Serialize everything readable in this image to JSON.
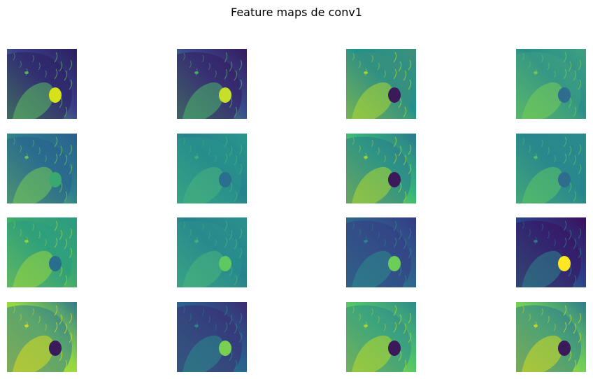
{
  "title": "Feature maps de conv1",
  "colormap": [
    "#440154",
    "#3b528b",
    "#21918c",
    "#5ec962",
    "#fde725"
  ],
  "feature_maps": [
    {
      "index": 1,
      "bg": "#3b3f8a",
      "fur": "#2a1f5e",
      "tongue": "#d8e219",
      "light": "#5ec962"
    },
    {
      "index": 2,
      "bg": "#3a4a8c",
      "fur": "#35195e",
      "tongue": "#c8df2a",
      "light": "#4cbf6b"
    },
    {
      "index": 3,
      "bg": "#21918c",
      "fur": "#3f8f7a",
      "tongue": "#3b1a5a",
      "light": "#b5de2b"
    },
    {
      "index": 4,
      "bg": "#2a8e8a",
      "fur": "#3fa080",
      "tongue": "#2f6c8e",
      "light": "#7ad151"
    },
    {
      "index": 5,
      "bg": "#2c7e8e",
      "fur": "#2a5f8e",
      "tongue": "#3aa86f",
      "light": "#7ad151"
    },
    {
      "index": 6,
      "bg": "#26828e",
      "fur": "#2a968b",
      "tongue": "#2b6f8e",
      "light": "#49b57c"
    },
    {
      "index": 7,
      "bg": "#35b779",
      "fur": "#2a788e",
      "tongue": "#3b1a5a",
      "light": "#b5de2b"
    },
    {
      "index": 8,
      "bg": "#25858e",
      "fur": "#2c8b8c",
      "tongue": "#2e6d8e",
      "light": "#5ec962"
    },
    {
      "index": 9,
      "bg": "#3aa870",
      "fur": "#2a9a83",
      "tongue": "#2a6e8e",
      "light": "#a0da39"
    },
    {
      "index": 10,
      "bg": "#26828e",
      "fur": "#2a918c",
      "tongue": "#5ec962",
      "light": "#4cb87a"
    },
    {
      "index": 11,
      "bg": "#30618d",
      "fur": "#343a84",
      "tongue": "#6ccd5a",
      "light": "#2b8f8c"
    },
    {
      "index": 12,
      "bg": "#2c3e87",
      "fur": "#3a0f5c",
      "tongue": "#fde725",
      "light": "#2c8a8d"
    },
    {
      "index": 13,
      "bg": "#8fd744",
      "fur": "#2f7b8e",
      "tongue": "#3b1a5a",
      "light": "#e2e418"
    },
    {
      "index": 14,
      "bg": "#2a5f8d",
      "fur": "#3c2a73",
      "tongue": "#7ad151",
      "light": "#2a8f8b"
    },
    {
      "index": 15,
      "bg": "#4fc46a",
      "fur": "#2f8a8c",
      "tongue": "#3b1a5a",
      "light": "#c2df23"
    },
    {
      "index": 16,
      "bg": "#6ccd5a",
      "fur": "#2d7c8e",
      "tongue": "#3b1a5a",
      "light": "#d9e21b"
    }
  ]
}
